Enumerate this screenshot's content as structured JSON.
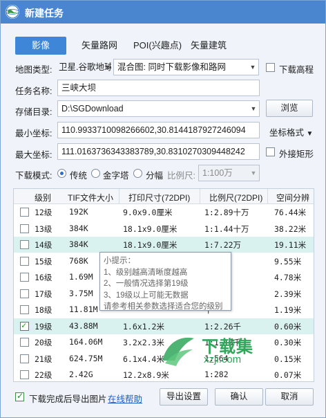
{
  "window": {
    "title": "新建任务"
  },
  "tabs": [
    {
      "label": "影像"
    },
    {
      "label": "矢量路网"
    },
    {
      "label": "POI(兴趣点)"
    },
    {
      "label": "矢量建筑"
    }
  ],
  "map_type": {
    "label": "地图类型:",
    "source": "卫星.谷歌地球",
    "mode": "混合图: 同时下载影像和路网",
    "elevation_label": "下载高程"
  },
  "task_name": {
    "label": "任务名称:",
    "value": "三峡大坝"
  },
  "storage": {
    "label": "存储目录:",
    "value": "D:\\SGDownload",
    "browse_label": "浏览"
  },
  "min_coord": {
    "label": "最小坐标:",
    "value": "110.9933710098266602,30.8144187927246094",
    "format_label": "坐标格式"
  },
  "max_coord": {
    "label": "最大坐标:",
    "value": "111.0163736343383789,30.8310270309448242",
    "outer_rect_label": "外接矩形"
  },
  "download_mode": {
    "label": "下载模式:",
    "options": [
      "传统",
      "金字塔",
      "分幅"
    ],
    "selected": "传统",
    "scale_label": "比例尺:",
    "scale_value": "1:100万"
  },
  "table": {
    "columns": [
      "级别",
      "TIF文件大小",
      "打印尺寸(72DPI)",
      "比例尺(72DPI)",
      "空间分辨"
    ],
    "rows": [
      {
        "level": "12级",
        "size": "192K",
        "print": "9.0x9.0厘米",
        "scale": "1:2.89十万",
        "res": "76.44米",
        "checked": false,
        "hl": false
      },
      {
        "level": "13级",
        "size": "384K",
        "print": "18.1x9.0厘米",
        "scale": "1:1.44十万",
        "res": "38.22米",
        "checked": false,
        "hl": false
      },
      {
        "level": "14级",
        "size": "384K",
        "print": "18.1x9.0厘米",
        "scale": "1:7.22万",
        "res": "19.11米",
        "checked": false,
        "hl": true
      },
      {
        "level": "15级",
        "size": "768K",
        "print": "",
        "scale": "万",
        "res": "9.55米",
        "checked": false,
        "hl": false
      },
      {
        "level": "16级",
        "size": "1.69M",
        "print": "",
        "scale": "万",
        "res": "4.78米",
        "checked": false,
        "hl": false
      },
      {
        "level": "17级",
        "size": "3.75M",
        "print": "",
        "scale": "千",
        "res": "2.39米",
        "checked": false,
        "hl": false
      },
      {
        "level": "18级",
        "size": "11.81M",
        "print": "",
        "scale": "千",
        "res": "1.19米",
        "checked": false,
        "hl": false
      },
      {
        "level": "19级",
        "size": "43.88M",
        "print": "1.6x1.2米",
        "scale": "1:2.26千",
        "res": "0.60米",
        "checked": true,
        "hl": true
      },
      {
        "level": "20级",
        "size": "164.06M",
        "print": "3.2x2.3米",
        "scale": "1:1.13千",
        "res": "0.30米",
        "checked": false,
        "hl": false
      },
      {
        "level": "21级",
        "size": "624.75M",
        "print": "6.1x4.4米",
        "scale": "1:564",
        "res": "0.15米",
        "checked": false,
        "hl": false
      },
      {
        "level": "22级",
        "size": "2.42G",
        "print": "12.2x8.9米",
        "scale": "1:282",
        "res": "0.07米",
        "checked": false,
        "hl": false
      }
    ]
  },
  "tooltip": {
    "title": "小提示：",
    "lines": [
      "1、级别越高清晰度越高",
      "2、一般情况选择第19级",
      "3、19级以上可能无数据",
      "请参考相关参数选择适合您的级别"
    ]
  },
  "watermark": {
    "brand": "下载集",
    "url": "xzji.com"
  },
  "footer": {
    "export_after_label": "下载完成后导出图片",
    "help_link": "在线帮助",
    "export_settings": "导出设置",
    "confirm": "确认",
    "cancel": "取消"
  },
  "colors": {
    "accent": "#3d86d8",
    "titlebar": "#4a86d0",
    "row_highlight": "#d9f2ef",
    "watermark": "#2fa65a"
  }
}
